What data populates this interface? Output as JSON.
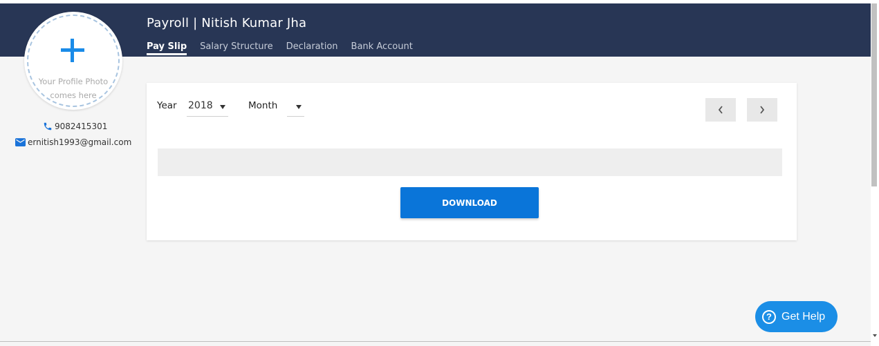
{
  "header": {
    "title": "Payroll | Nitish Kumar Jha",
    "tabs": [
      {
        "label": "Pay Slip",
        "active": true
      },
      {
        "label": "Salary Structure",
        "active": false
      },
      {
        "label": "Declaration",
        "active": false
      },
      {
        "label": "Bank Account",
        "active": false
      }
    ],
    "background_color": "#283655"
  },
  "profile": {
    "photo_placeholder_line1": "Your Profile Photo",
    "photo_placeholder_line2": "comes here",
    "phone": "9082415301",
    "email": "ernitish1993@gmail.com",
    "icons": [
      "plus-icon",
      "phone-icon",
      "mail-icon"
    ]
  },
  "payslip": {
    "year_label": "Year",
    "year_value": "2018",
    "month_label": "Month",
    "month_value": "",
    "download_label": "DOWNLOAD",
    "prev_icon": "chevron-left-icon",
    "next_icon": "chevron-right-icon"
  },
  "help": {
    "label": "Get Help",
    "icon": "question-circle-icon"
  },
  "colors": {
    "accent": "#0a75d9",
    "help_button": "#1b8ee6",
    "page_background": "#f5f5f5"
  }
}
